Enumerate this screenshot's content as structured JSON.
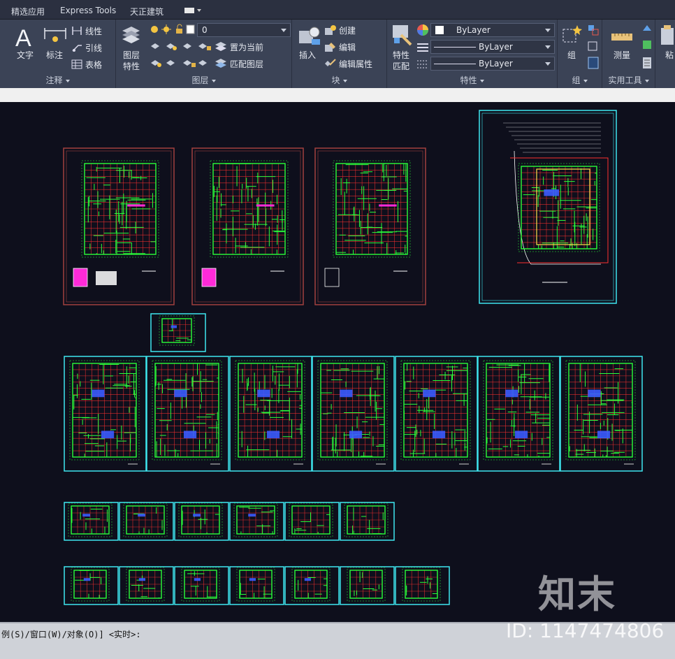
{
  "tabs": [
    "精选应用",
    "Express Tools",
    "天正建筑"
  ],
  "ribbon": {
    "annotation": {
      "text_label": "文字",
      "dim_label": "标注",
      "linear_label": "线性",
      "leader_label": "引线",
      "table_label": "表格",
      "panel_title": "注释"
    },
    "layers": {
      "props_label_1": "图层",
      "props_label_2": "特性",
      "layer_value": "0",
      "set_current_label": "置为当前",
      "match_layer_label": "匹配图层",
      "panel_title": "图层"
    },
    "block": {
      "insert_label": "插入",
      "create_label": "创建",
      "edit_label": "编辑",
      "edit_attr_label": "编辑属性",
      "panel_title": "块"
    },
    "properties": {
      "match_label_1": "特性",
      "match_label_2": "匹配",
      "color_value": "ByLayer",
      "linetype_value": "ByLayer",
      "lineweight_value": "ByLayer",
      "panel_title": "特性"
    },
    "group": {
      "group_label": "组",
      "panel_title": "组"
    },
    "utilities": {
      "measure_label": "测量",
      "panel_title": "实用工具"
    },
    "clipboard": {
      "paste_label": "粘"
    }
  },
  "command_line": "例(S)/窗口(W)/对象(O)] <实时>:",
  "watermark": {
    "brand": "知末",
    "id": "ID: 1147474806"
  },
  "colors": {
    "canvas_bg": "#0e0f1c",
    "sheet_border_red": "#a2403e",
    "sheet_border_cyan": "#3fe7f0",
    "plan_green": "#2aff3a",
    "plan_red": "#ff3030",
    "plan_blue": "#3a5bff",
    "plan_magenta": "#ff2ad8"
  }
}
